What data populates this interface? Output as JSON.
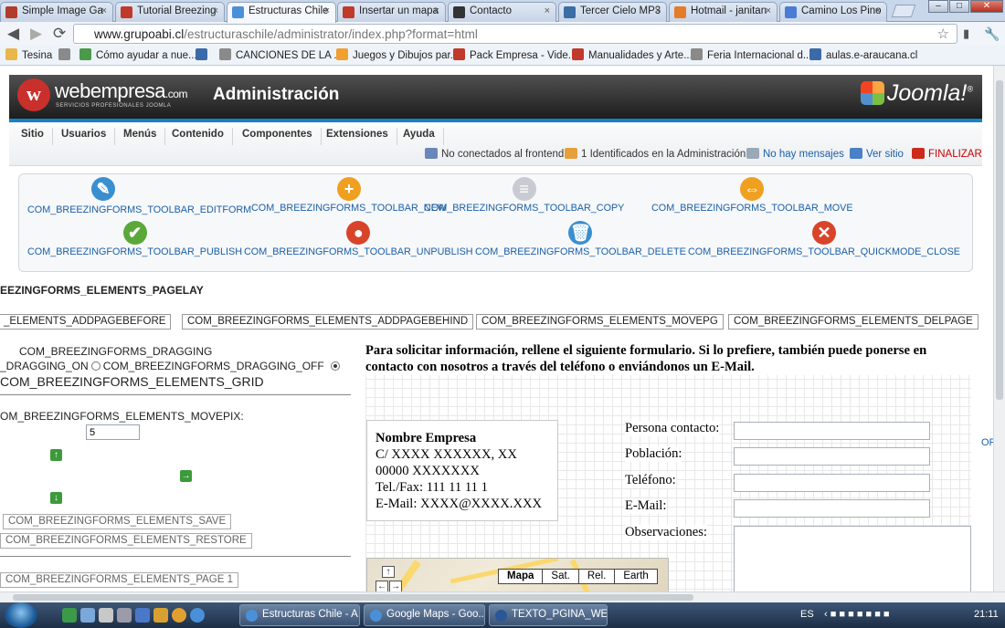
{
  "browser": {
    "tabs": [
      {
        "label": "Simple Image Ga",
        "fav": "#b23c2b"
      },
      {
        "label": "Tutorial Breezing",
        "fav": "#c0392b"
      },
      {
        "label": "Estructuras Chile",
        "fav": "#4a90d9"
      },
      {
        "label": "Insertar un mapa",
        "fav": "#c0392b"
      },
      {
        "label": "Contacto",
        "fav": "#333333"
      },
      {
        "label": "Tercer Cielo MP3",
        "fav": "#3a6ea5"
      },
      {
        "label": "Hotmail - janitan",
        "fav": "#e57c2a"
      },
      {
        "label": "Camino Los Pino",
        "fav": "#4a7cd6"
      }
    ],
    "tab_close": "×",
    "url_host": "www.grupoabi.cl",
    "url_path": "/estructuraschile/administrator/index.php?format=html",
    "back_icon": "◀",
    "forward_icon": "▶",
    "reload_icon": "⟳",
    "star_icon": "☆",
    "bookmarks": [
      {
        "label": "Tesina",
        "color": "#e9b64a"
      },
      {
        "label": "",
        "color": "#8a8a8a"
      },
      {
        "label": "Cómo ayudar a nue...",
        "color": "#4a9a4a"
      },
      {
        "label": "",
        "color": "#3b6aa8"
      },
      {
        "label": "CANCIONES DE LA ...",
        "color": "#8a8a8a"
      },
      {
        "label": "Juegos y Dibujos par...",
        "color": "#f0a030"
      },
      {
        "label": "Pack Empresa - Vide...",
        "color": "#c0392b"
      },
      {
        "label": "Manualidades y Arte...",
        "color": "#c0392b"
      },
      {
        "label": "Feria Internacional d...",
        "color": "#8a8a8a"
      },
      {
        "label": "aulas.e-araucana.cl",
        "color": "#3b6aa8"
      }
    ]
  },
  "header": {
    "brand": "webempresa",
    "brand_tld": ".com",
    "brand_sub": "SERVICIOS PROFESIONALES JOOMLA",
    "title": "Administración",
    "joomla": "Joomla!",
    "joomla_mark": "®"
  },
  "menu": [
    "Sitio",
    "Usuarios",
    "Menús",
    "Contenido",
    "Componentes",
    "Extensiones",
    "Ayuda"
  ],
  "status": [
    {
      "label": "No conectados al frontend",
      "kind": "plain",
      "icon": "#6b86b8"
    },
    {
      "label": "1 Identificados en la Administración",
      "kind": "plain",
      "icon": "#e5a03a"
    },
    {
      "label": "No hay mensajes",
      "kind": "blue",
      "icon": "#9aa8b8"
    },
    {
      "label": "Ver sitio",
      "kind": "blue",
      "icon": "#4a80c8"
    },
    {
      "label": "FINALIZAR",
      "kind": "red",
      "icon": "#cc2a1a"
    }
  ],
  "toolbar": [
    {
      "label": "COM_BREEZINGFORMS_TOOLBAR_EDITFORM",
      "icon": "✎",
      "color": "#3a8fd0",
      "name": "editform"
    },
    {
      "label": "COM_BREEZINGFORMS_TOOLBAR_NEW",
      "icon": "+",
      "color": "#f0a020",
      "name": "new"
    },
    {
      "label": "COM_BREEZINGFORMS_TOOLBAR_COPY",
      "icon": "≡",
      "color": "#c8ccd2",
      "name": "copy"
    },
    {
      "label": "COM_BREEZINGFORMS_TOOLBAR_MOVE",
      "icon": "⇔",
      "color": "#f0a020",
      "name": "move"
    },
    {
      "label": "COM_BREEZINGFORMS_TOOLBAR_PUBLISH",
      "icon": "✔",
      "color": "#5aa83a",
      "name": "publish"
    },
    {
      "label": "COM_BREEZINGFORMS_TOOLBAR_UNPUBLISH",
      "icon": "●",
      "color": "#d8442a",
      "name": "unpublish"
    },
    {
      "label": "COM_BREEZINGFORMS_TOOLBAR_DELETE",
      "icon": "🗑",
      "color": "#3a8fd0",
      "name": "delete"
    },
    {
      "label": "COM_BREEZINGFORMS_TOOLBAR_QUICKMODE_CLOSE",
      "icon": "✕",
      "color": "#d8442a",
      "name": "quickmode-close"
    }
  ],
  "editor": {
    "section_title": "EEZINGFORMS_ELEMENTS_PAGELAY",
    "page_buttons": [
      "_ELEMENTS_ADDPAGEBEFORE",
      "COM_BREEZINGFORMS_ELEMENTS_ADDPAGEBEHIND",
      "COM_BREEZINGFORMS_ELEMENTS_MOVEPG",
      "COM_BREEZINGFORMS_ELEMENTS_DELPAGE"
    ],
    "dragging": "COM_BREEZINGFORMS_DRAGGING",
    "dragging_on": "_DRAGGING_ON",
    "dragging_off": "COM_BREEZINGFORMS_DRAGGING_OFF",
    "grid": "COM_BREEZINGFORMS_ELEMENTS_GRID",
    "movepix_label": "OM_BREEZINGFORMS_ELEMENTS_MOVEPIX:",
    "movepix_value": "5",
    "arrow_up": "↑",
    "arrow_right": "→",
    "arrow_down": "↓",
    "save": "COM_BREEZINGFORMS_ELEMENTS_SAVE",
    "restore": "COM_BREEZINGFORMS_ELEMENTS_RESTORE",
    "page1": "COM_BREEZINGFORMS_ELEMENTS_PAGE 1",
    "edge_text": "OF"
  },
  "form": {
    "intro": "Para solicitar información, rellene el siguiente formulario. Si lo prefiere, también puede ponerse en contacto con nosotros a través del teléfono o enviándonos un E-Mail.",
    "company": [
      "Nombre Empresa",
      "C/ XXXX XXXXXX, XX",
      "00000 XXXXXXX",
      "Tel./Fax: 111 11 11 1",
      "E-Mail: XXXX@XXXX.XXX"
    ],
    "fields": [
      "Persona contacto:",
      "Población:",
      "Teléfono:",
      "E-Mail:",
      "Observaciones:"
    ],
    "map_buttons": [
      "Mapa",
      "Sat.",
      "Rel.",
      "Earth"
    ]
  },
  "taskbar": {
    "items": [
      {
        "label": "Estructuras Chile - A...",
        "color": "#4a90d9"
      },
      {
        "label": "Google Maps - Goo...",
        "color": "#4a90d9"
      },
      {
        "label": "TEXTO_PGINA_WEB...",
        "color": "#2b5797"
      }
    ],
    "lang": "ES",
    "time": "21:11"
  }
}
